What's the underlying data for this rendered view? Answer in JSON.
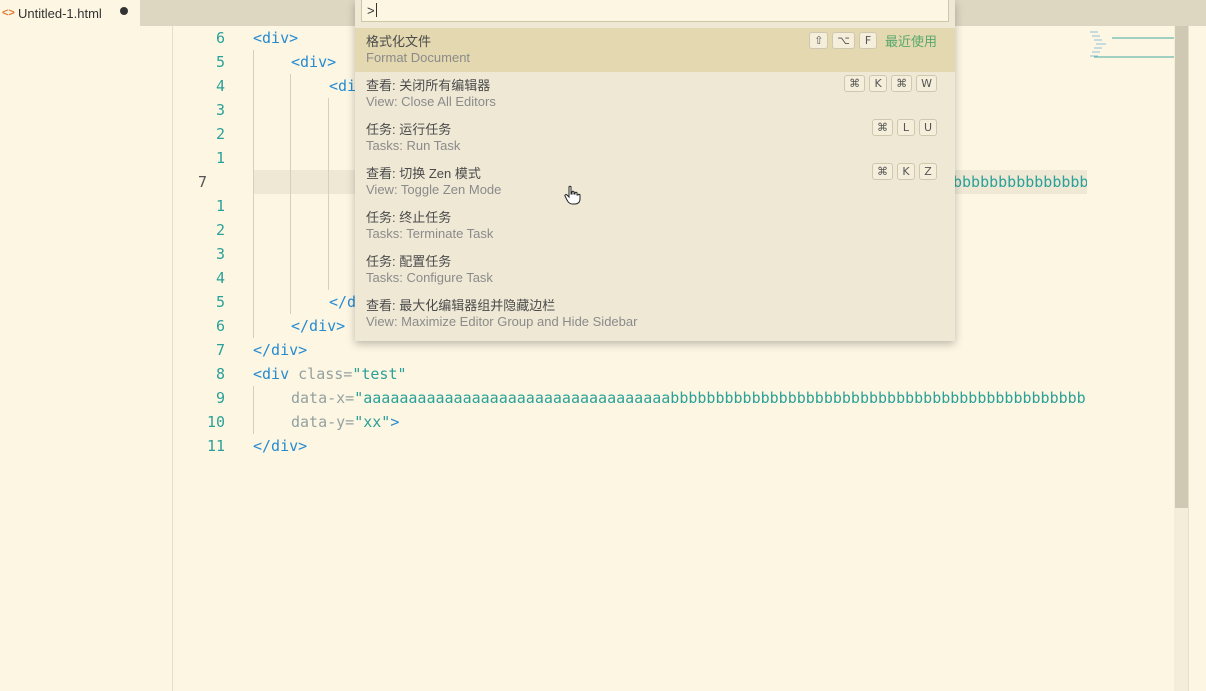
{
  "tab": {
    "icon": "html-file-icon",
    "title": "Untitled-1.html",
    "dirty": true
  },
  "gutter": {
    "line_numbers": [
      "6",
      "5",
      "4",
      "3",
      "2",
      "1",
      "7",
      "1",
      "2",
      "3",
      "4",
      "5",
      "6",
      "7",
      "8",
      "9",
      "10",
      "11"
    ],
    "current_index": 6
  },
  "code": {
    "l0": "<div>",
    "l1": "<div>",
    "l2": "<di",
    "l6_tail": "bbbbbbbbbbbbbbb",
    "l11": "</d",
    "l12": "</div>",
    "l13": "</div>",
    "l14_open": "<div",
    "l14_attr": " class=",
    "l14_str": "\"test\"",
    "l15_attr": "data-x=",
    "l15_str": "\"aaaaaaaaaaaaaaaaaaaaaaaaaaaaaaaaaabbbbbbbbbbbbbbbbbbbbbbbbbbbbbbbbbbbbbbbbbbbbbbb",
    "l16_attr": "data-y=",
    "l16_str": "\"xx\"",
    "l16_close": ">",
    "l17": "</div>"
  },
  "palette": {
    "input_value": ">",
    "items": [
      {
        "label": "格式化文件",
        "detail": "Format Document",
        "keys": [
          "⇧",
          "⌥",
          "F"
        ],
        "badge": "最近使用",
        "selected": true
      },
      {
        "label": "查看: 关闭所有编辑器",
        "detail": "View: Close All Editors",
        "keys": [
          "⌘",
          "K",
          "⌘",
          "W"
        ]
      },
      {
        "label": "任务: 运行任务",
        "detail": "Tasks: Run Task",
        "keys": [
          "⌘",
          "L",
          "U"
        ]
      },
      {
        "label": "查看: 切换 Zen 模式",
        "detail": "View: Toggle Zen Mode",
        "keys": [
          "⌘",
          "K",
          "Z"
        ]
      },
      {
        "label": "任务: 终止任务",
        "detail": "Tasks: Terminate Task",
        "keys": []
      },
      {
        "label": "任务: 配置任务",
        "detail": "Tasks: Configure Task",
        "keys": []
      },
      {
        "label": "查看: 最大化编辑器组并隐藏边栏",
        "detail": "View: Maximize Editor Group and Hide Sidebar",
        "keys": []
      }
    ]
  },
  "colors": {
    "background": "#fdf6e3",
    "tag": "#268bd2",
    "string": "#2aa198",
    "selection": "#e3d8b0",
    "badge": "#5aa86c"
  },
  "cursor": {
    "icon": "hand-pointer-icon"
  }
}
